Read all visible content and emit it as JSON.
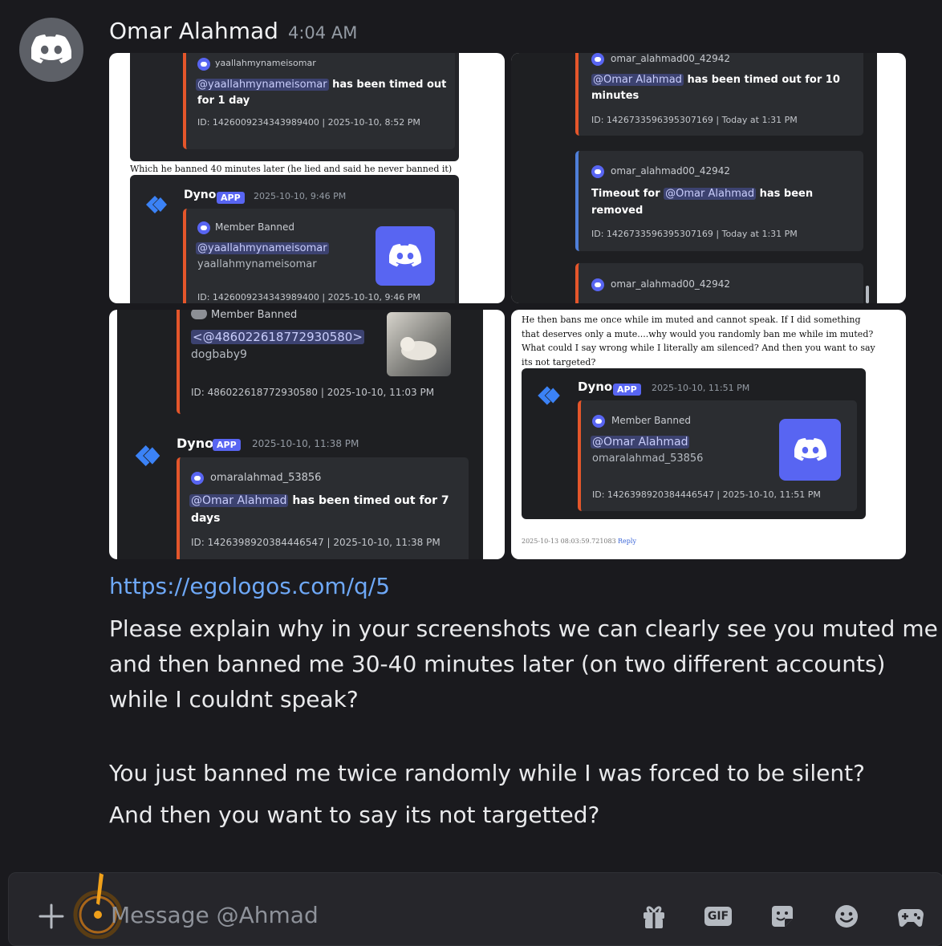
{
  "message": {
    "author": "Omar Alahmad",
    "timestamp": "4:04 AM",
    "link": "https://egologos.com/q/5",
    "paragraph1_lines": [
      "Please explain why in your screenshots we can clearly see you muted me",
      "and then banned me 30-40 minutes later (on two different accounts)",
      "while I couldnt speak?"
    ],
    "paragraph2_lines": [
      "You just banned me twice randomly while I was forced to be silent?",
      "And then you want to say its not targetted?"
    ]
  },
  "att1": {
    "user": "yaallahmynameisomar",
    "mention": "@yaallahmynameisomar",
    "action": " has been timed out",
    "duration": "for 1 day",
    "id_line": "ID: 1426009234343989400 | 2025-10-10, 8:52 PM",
    "caption": "Which he banned 40 minutes later (he lied and said he never banned it)",
    "bot": "Dyno",
    "app": "APP",
    "bot_time": "2025-10-10, 9:46 PM",
    "embed_title": "Member Banned",
    "ban_mention": "@yaallahmynameisomar",
    "ban_user": "yaallahmynameisomar",
    "ban_id_line": "ID: 1426009234343989400 | 2025-10-10, 9:46 PM"
  },
  "att2": {
    "user1": "omar_alahmad00_42942",
    "mention1": "@Omar Alahmad",
    "action1": " has been timed out for 10",
    "action1b": "minutes",
    "id1": "ID: 1426733596395307169 | Today at 1:31 PM",
    "user2": "omar_alahmad00_42942",
    "timeout_prefix": "Timeout for ",
    "mention2": "@Omar Alahmad",
    "action2": " has been",
    "action2b": "removed",
    "id2": "ID: 1426733596395307169 | Today at 1:31 PM",
    "user3": "omar_alahmad00_42942"
  },
  "att3": {
    "embed_title": "Member Banned",
    "mention": "<@486022618772930580>",
    "user": "dogbaby9",
    "id_line": "ID: 486022618772930580 | 2025-10-10, 11:03 PM",
    "bot": "Dyno",
    "app": "APP",
    "bot_time": "2025-10-10, 11:38 PM",
    "user2": "omaralahmad_53856",
    "mention2": "@Omar Alahmad",
    "action2": " has been timed out for 7",
    "action2b": "days",
    "id2": "ID: 1426398920384446547 | 2025-10-10, 11:38 PM"
  },
  "att4": {
    "para_lines": [
      "He then bans me once while im muted and cannot speak. If I did something",
      "that deserves only a mute....why would you randomly ban me while im muted?",
      "What could I say wrong while I literally am silenced? And then you want to say",
      "its not targeted?"
    ],
    "bot": "Dyno",
    "app": "APP",
    "bot_time": "2025-10-10, 11:51 PM",
    "embed_title": "Member Banned",
    "mention": "@Omar Alahmad",
    "user": "omaralahmad_53856",
    "id_line": "ID: 1426398920384446547 | 2025-10-10, 11:51 PM",
    "footer_time": "2025-10-13 08:03:59.721083",
    "reply": "Reply"
  },
  "composer": {
    "placeholder": "Message @Ahmad",
    "gif_label": "GIF"
  },
  "icons": [
    "discord-logo-icon",
    "dyno-logo-icon",
    "plus-icon",
    "gift-icon",
    "gif-icon",
    "sticker-icon",
    "emoji-icon",
    "gamepad-icon",
    "alert-icon"
  ],
  "colors": {
    "background": "#1a1a1e",
    "blurple": "#5865f2",
    "link": "#6ea8f7",
    "embed_red": "#e4562b",
    "embed_blue": "#4f7fd9"
  }
}
